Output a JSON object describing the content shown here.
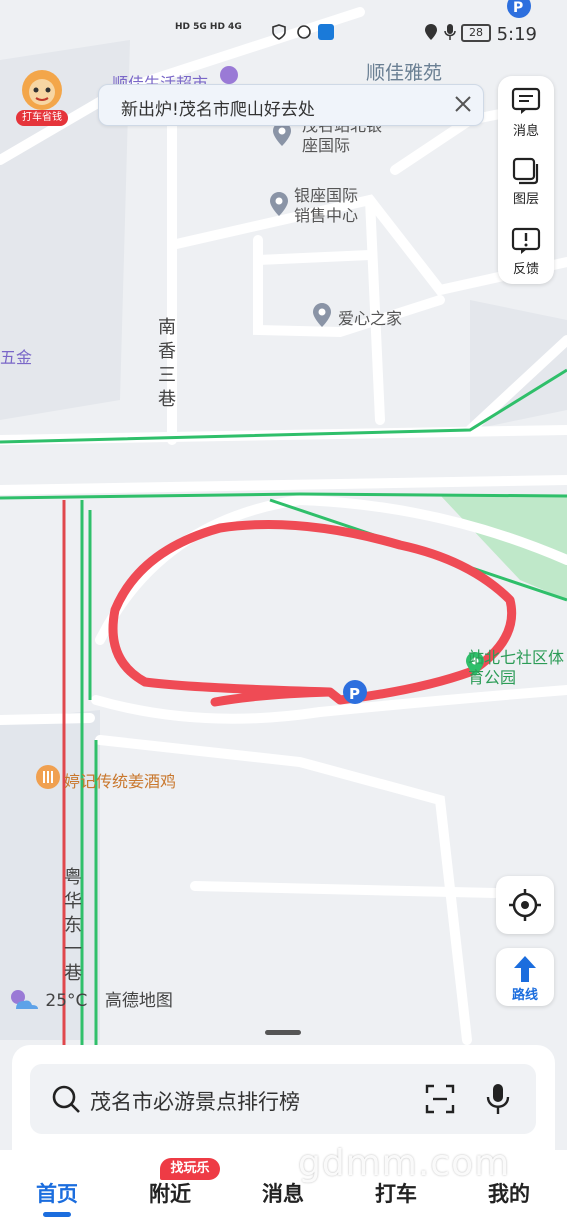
{
  "status_bar": {
    "signal_text": "HD 5G HD 4G",
    "battery": "28",
    "time": "5:19"
  },
  "promo_badge": {
    "label": "打车省钱"
  },
  "tip_banner": {
    "text": "新出炉!茂名市爬山好去处"
  },
  "side_panel": {
    "messages_label": "消息",
    "layers_label": "图层",
    "feedback_label": "反馈"
  },
  "route_button": {
    "label": "路线"
  },
  "map_labels": {
    "supermarket": "顺佳生活超市",
    "residence": "顺佳雅苑",
    "plaza": "茂名站北银座国际",
    "sales_center": "银座国际销售中心",
    "love_home": "爱心之家",
    "wujin": "五金",
    "lane3": "南香三巷",
    "park": "站北七社区体育公园",
    "restaurant": "婷记传统姜酒鸡",
    "lane1": "粤华东一巷",
    "attribution": "高德地图"
  },
  "weather": {
    "temperature": "25°C"
  },
  "search": {
    "placeholder": "茂名市必游景点排行榜"
  },
  "tabs": {
    "home": "首页",
    "nearby": "附近",
    "nearby_badge": "找玩乐",
    "messages": "消息",
    "taxi": "打车",
    "mine": "我的"
  },
  "watermark": "gdmm.com",
  "colors": {
    "accent": "#1b6dde",
    "road_green": "#2fbf6a",
    "road_red": "#e0474c",
    "annotation": "#ef4b55"
  }
}
